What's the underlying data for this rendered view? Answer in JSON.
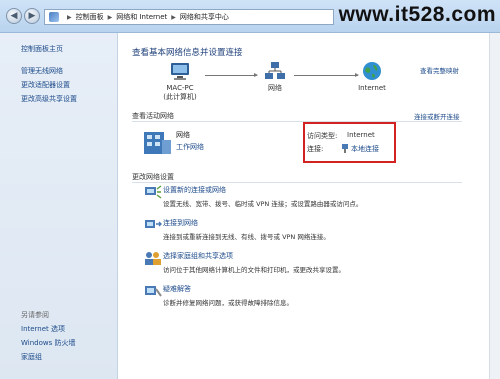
{
  "toolbar": {
    "breadcrumb": [
      "控制面板",
      "网络和 Internet",
      "网络和共享中心"
    ],
    "watermark": "www.it528.com"
  },
  "sidebar": {
    "home": "控制面板主页",
    "items": [
      "管理无线网络",
      "更改适配器设置",
      "更改高级共享设置"
    ],
    "see_also_label": "另请参阅",
    "see_also": [
      "Internet 选项",
      "Windows 防火墙",
      "家庭组"
    ]
  },
  "main": {
    "title": "查看基本网络信息并设置连接",
    "full_map_link": "查看完整映射",
    "map": {
      "computer_name": "MAC-PC",
      "computer_sub": "(此计算机)",
      "network": "网络",
      "internet": "Internet"
    },
    "active_section": "查看活动网络",
    "connect_link": "连接或断开连接",
    "network_name": "网络",
    "network_type": "工作网络",
    "access_type_label": "访问类型:",
    "access_type_value": "Internet",
    "connection_label": "连接:",
    "connection_value": "本地连接",
    "change_section": "更改网络设置",
    "tasks": [
      {
        "title": "设置新的连接或网络",
        "desc": "设置无线、宽带、拨号、临时或 VPN 连接；或设置路由器或访问点。"
      },
      {
        "title": "连接到网络",
        "desc": "连接到或重新连接到无线、有线、拨号或 VPN 网络连接。"
      },
      {
        "title": "选择家庭组和共享选项",
        "desc": "访问位于其他网络计算机上的文件和打印机，或更改共享设置。"
      },
      {
        "title": "疑难解答",
        "desc": "诊断并修复网络问题，或获得故障排除信息。"
      }
    ]
  },
  "colors": {
    "accent_link": "#1c4a8a",
    "highlight": "#d32222",
    "title": "#1e3f7a"
  }
}
